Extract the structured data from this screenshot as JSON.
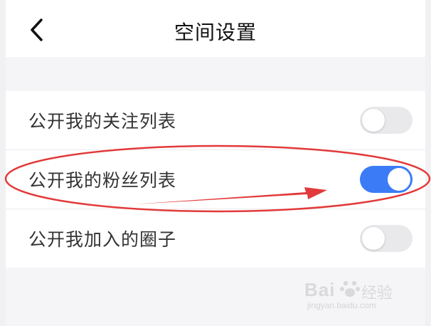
{
  "header": {
    "title": "空间设置",
    "back_icon": "chevron-left-icon"
  },
  "settings": [
    {
      "label": "公开我的关注列表",
      "enabled": false
    },
    {
      "label": "公开我的粉丝列表",
      "enabled": true
    },
    {
      "label": "公开我加入的圈子",
      "enabled": false
    }
  ],
  "colors": {
    "toggle_on": "#3b7cf6",
    "toggle_off": "#e9e9ec",
    "annotation": "#e23a3a"
  },
  "watermark": {
    "brand": "Bai",
    "brand_cn": "经验",
    "url": "jingyan.baidu.com"
  }
}
